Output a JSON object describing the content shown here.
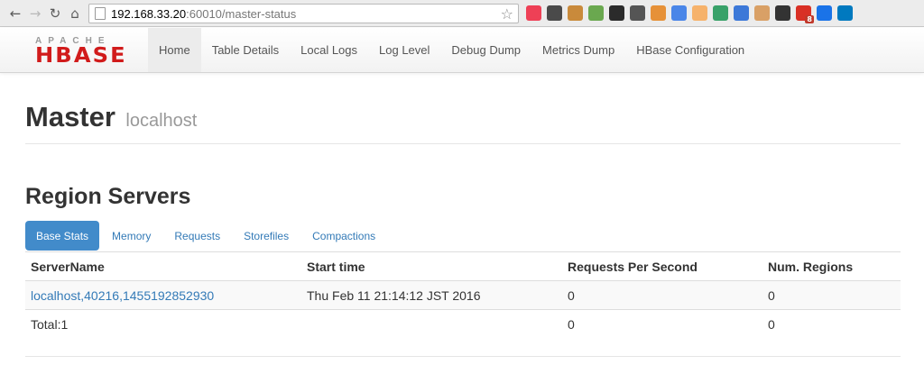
{
  "browser": {
    "url_host": "192.168.33.20",
    "url_path": ":60010/master-status",
    "extensions": [
      {
        "name": "pocket-icon",
        "color": "#ee4056"
      },
      {
        "name": "evernote-icon",
        "color": "#4a4a4a"
      },
      {
        "name": "cookie-icon",
        "color": "#c98a3b"
      },
      {
        "name": "clipper-icon",
        "color": "#6aa84f"
      },
      {
        "name": "colorpicker-icon",
        "color": "#2b2b2b"
      },
      {
        "name": "recycle-icon",
        "color": "#555555"
      },
      {
        "name": "palette-icon",
        "color": "#e69138"
      },
      {
        "name": "chat-icon",
        "color": "#4a86e8"
      },
      {
        "name": "analytics-icon",
        "color": "#f6b26b"
      },
      {
        "name": "badge-icon",
        "color": "#38a169"
      },
      {
        "name": "vimium-icon",
        "color": "#3c78d8"
      },
      {
        "name": "face-icon",
        "color": "#d9a066"
      },
      {
        "name": "terminal-icon",
        "color": "#333333"
      },
      {
        "name": "gmail-icon",
        "color": "#d93025",
        "badge": "8"
      },
      {
        "name": "infinity-icon",
        "color": "#1a73e8"
      },
      {
        "name": "trello-icon",
        "color": "#0079bf"
      }
    ]
  },
  "logo": {
    "top": "APACHE",
    "main": "HBASE"
  },
  "nav": {
    "items": [
      "Home",
      "Table Details",
      "Local Logs",
      "Log Level",
      "Debug Dump",
      "Metrics Dump",
      "HBase Configuration"
    ]
  },
  "header": {
    "title": "Master",
    "subtitle": "localhost"
  },
  "region_servers": {
    "title": "Region Servers",
    "tabs": [
      "Base Stats",
      "Memory",
      "Requests",
      "Storefiles",
      "Compactions"
    ],
    "columns": [
      "ServerName",
      "Start time",
      "Requests Per Second",
      "Num. Regions"
    ],
    "rows": [
      [
        "localhost,40216,1455192852930",
        "Thu Feb 11 21:14:12 JST 2016",
        "0",
        "0"
      ],
      [
        "Total:1",
        "",
        "0",
        "0"
      ]
    ]
  }
}
